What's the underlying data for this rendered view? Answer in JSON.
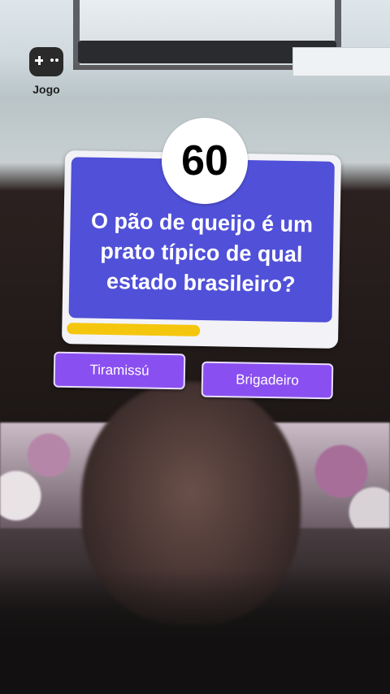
{
  "app": {
    "badge_label": "Jogo",
    "icon": "gamepad-icon"
  },
  "quiz": {
    "timer": "60",
    "question": "O pão de queijo é um prato típico de qual estado brasileiro?",
    "progress_fraction": 0.5,
    "answers": [
      {
        "label": "Tiramissú"
      },
      {
        "label": "Brigadeiro"
      }
    ]
  },
  "colors": {
    "card_blue": "#5050d8",
    "answer_purple": "#8a4ff0",
    "progress_yellow": "#f5c60e"
  }
}
